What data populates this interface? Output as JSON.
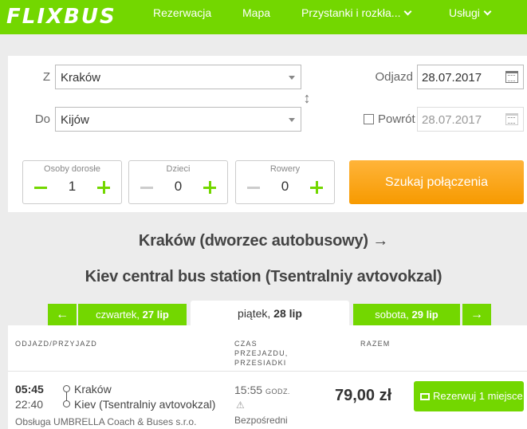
{
  "header": {
    "logo": "FLIXBUS",
    "nav": [
      "Rezerwacja",
      "Mapa",
      "Przystanki i rozkła...",
      "Usługi"
    ]
  },
  "search": {
    "from_label": "Z",
    "from_value": "Kraków",
    "to_label": "Do",
    "to_value": "Kijów",
    "depart_label": "Odjazd",
    "depart_value": "28.07.2017",
    "return_label": "Powrót",
    "return_value": "28.07.2017",
    "adults_label": "Osoby dorosłe",
    "adults_value": "1",
    "children_label": "Dzieci",
    "children_value": "0",
    "bikes_label": "Rowery",
    "bikes_value": "0",
    "button": "Szukaj połączenia"
  },
  "route": {
    "line1": "Kraków (dworzec autobusowy) →",
    "line2": "Kiev central bus station (Tsentralniy avtovokzal)"
  },
  "days": {
    "prev_arrow": "←",
    "prev_day": "czwartek,",
    "prev_date": "27 lip",
    "active_day": "piątek,",
    "active_date": "28 lip",
    "next_day": "sobota,",
    "next_date": "29 lip",
    "next_arrow": "→"
  },
  "columns": {
    "depart_arrive": "ODJAZD/PRZYJAZD",
    "duration_1": "CZAS",
    "duration_2": "PRZEJAZDU,",
    "duration_3": "PRZESIADKI",
    "total": "RAZEM"
  },
  "result": {
    "dep_time": "05:45",
    "arr_time": "22:40",
    "dep_stop": "Kraków",
    "arr_stop": "Kiev (Tsentralniy avtovokzal)",
    "operator": "Obsługa UMBRELLA Coach & Buses s.r.o.",
    "duration": "15:55",
    "duration_unit": "GODZ.",
    "transfer": "Bezpośredni",
    "price": "79,00 zł",
    "book_button": "Rezerwuj 1 miejsce"
  },
  "icons": {
    "calendar": "calendar-icon",
    "swap": "swap-icon",
    "warning": "warning-icon",
    "cart": "cart-icon"
  },
  "colors": {
    "brand": "#73d700",
    "cta": "#f79a00"
  }
}
